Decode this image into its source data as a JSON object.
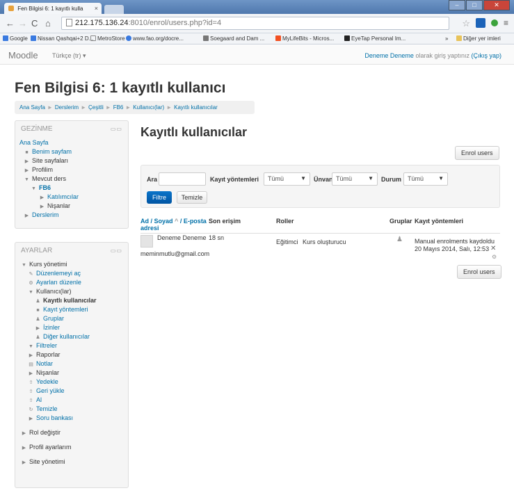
{
  "browser": {
    "tab_title": "Fen Bilgisi 6: 1 kayıtlı kulla",
    "tab_close": "×",
    "url_host": "212.175.136.24",
    "url_path": ":8010/enrol/users.php?id=4",
    "bookmarks": [
      "Google",
      "Nissan Qashqai+2 D...",
      "MetroStore",
      "www.fao.org/docre...",
      "Soegaard and Dam ...",
      "MyLifeBits - Micros...",
      "EyeTap Personal Im..."
    ],
    "bookmarks_more": "»",
    "other_bookmarks": "Diğer yer imleri"
  },
  "moodle": {
    "brand": "Moodle",
    "language": "Türkçe (tr)",
    "login_text": "Deneme Deneme olarak giriş yaptınız",
    "login_user": "Deneme Deneme",
    "logout": "(Çıkış yap)"
  },
  "page": {
    "title": "Fen Bilgisi 6: 1 kayıtlı kullanıcı",
    "breadcrumb": [
      "Ana Sayfa",
      "Derslerim",
      "Çeşitli",
      "FB6",
      "Kullanıcı(lar)",
      "Kayıtlı kullanıcılar"
    ]
  },
  "navigation": {
    "title": "GEZİNME",
    "items": [
      "Ana Sayfa",
      "Benim sayfam",
      "Site sayfaları",
      "Profilim",
      "Mevcut ders",
      "FB6",
      "Katılımcılar",
      "Nişanlar",
      "Derslerim"
    ]
  },
  "settings": {
    "title": "AYARLAR",
    "items": [
      "Kurs yönetimi",
      "Düzenlemeyi aç",
      "Ayarları düzenle",
      "Kullanıcı(lar)",
      "Kayıtlı kullanıcılar",
      "Kayıt yöntemleri",
      "Gruplar",
      "İzinler",
      "Diğer kullanıcılar",
      "Filtreler",
      "Raporlar",
      "Notlar",
      "Nişanlar",
      "Yedekle",
      "Geri yükle",
      "Al",
      "Temizle",
      "Soru bankası",
      "Rol değiştir",
      "Profil ayarlarım",
      "Site yönetimi"
    ]
  },
  "main": {
    "heading": "Kayıtlı kullanıcılar",
    "enrol_button": "Enrol users",
    "filters": {
      "search_label": "Ara",
      "search_value": "",
      "method_label": "Kayıt yöntemleri",
      "method_value": "Tümü",
      "role_label": "Ünvan",
      "role_value": "Tümü",
      "status_label": "Durum",
      "status_value": "Tümü",
      "filter_button": "Filtre",
      "clear_button": "Temizle"
    },
    "table": {
      "col_name_1": "Ad / Soyad",
      "col_name_sort": "^",
      "col_name_2": "/ E-posta",
      "col_name_3": "adresi",
      "col_lastaccess": "Son erişim",
      "col_roles": "Roller",
      "col_groups": "Gruplar",
      "col_methods": "Kayıt yöntemleri",
      "rows": [
        {
          "name": "Deneme Deneme",
          "email": "meminmutlu@gmail.com",
          "lastaccess": "18 sn",
          "role": "Eğitimci",
          "role_extra": "Kurs oluşturucu",
          "enrol_method": "Manual enrolments kaydoldu",
          "enrol_date": "20 Mayıs 2014, Salı, 12:53"
        }
      ]
    }
  },
  "colors": {
    "link": "#0070a8",
    "primary_button": "#0a66bb",
    "page_bg": "#ffffff",
    "block_bg": "#f5f5f5"
  }
}
